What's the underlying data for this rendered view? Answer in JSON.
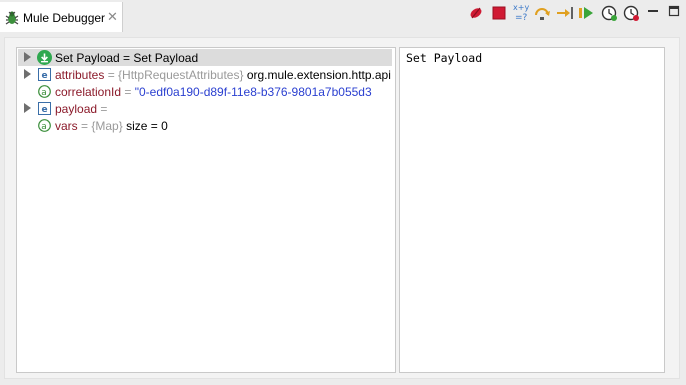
{
  "tab": {
    "title": "Mule Debugger",
    "icon": "bug-icon",
    "close_icon": "close-icon"
  },
  "toolbar": {
    "items": [
      {
        "name": "clear-breakpoints-icon",
        "color": "#d01a33"
      },
      {
        "name": "stop-icon",
        "color": "#d01a33"
      },
      {
        "name": "expression-icon",
        "color": "#3a78c8"
      },
      {
        "name": "step-over-icon",
        "color": "#e0a020"
      },
      {
        "name": "step-into-icon",
        "color": "#e0a020"
      },
      {
        "name": "resume-icon",
        "color": "#3aa53a"
      },
      {
        "name": "run-to-processor-icon",
        "color": "#333333"
      },
      {
        "name": "stop-at-time-icon",
        "color": "#d01a33"
      },
      {
        "name": "minimize-icon",
        "color": "#333333"
      },
      {
        "name": "maximize-icon",
        "color": "#333333"
      }
    ]
  },
  "tree": {
    "rows": [
      {
        "expandable": true,
        "icon": "message-processor-icon",
        "name": "Set Payload",
        "eq": " = ",
        "value": "Set Payload",
        "selected": true
      },
      {
        "expandable": true,
        "icon": "class-icon",
        "name": "attributes",
        "eq": " = ",
        "type": "{HttpRequestAttributes}",
        "value": "org.mule.extension.http.api"
      },
      {
        "expandable": false,
        "icon": "attribute-icon",
        "name": "correlationId",
        "eq": " = ",
        "value": "\"0-edf0a190-d89f-11e8-b376-9801a7b055d3"
      },
      {
        "expandable": true,
        "icon": "class-icon",
        "name": "payload",
        "eq": " = ",
        "value": ""
      },
      {
        "expandable": false,
        "icon": "attribute-icon",
        "name": "vars",
        "eq": " = ",
        "type": "{Map}",
        "value": "size = 0"
      }
    ]
  },
  "detail": {
    "text": "Set Payload"
  },
  "colors": {
    "accent_green": "#2fa84f",
    "name_red": "#8b1a2a",
    "string_blue": "#2a3fd0"
  }
}
